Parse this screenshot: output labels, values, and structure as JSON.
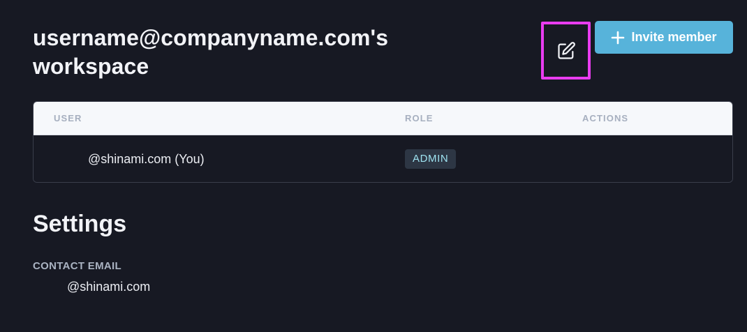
{
  "workspace": {
    "title": "username@companyname.com's workspace"
  },
  "actions": {
    "edit_icon": "edit-icon",
    "invite_label": "Invite member",
    "invite_icon": "plus-icon",
    "accent_color": "#57b3da",
    "highlight_color": "#e93cf0"
  },
  "members_table": {
    "columns": [
      "USER",
      "ROLE",
      "ACTIONS"
    ],
    "rows": [
      {
        "user": "@shinami.com (You)",
        "role": "ADMIN"
      }
    ]
  },
  "settings": {
    "heading": "Settings",
    "contact_email_label": "CONTACT EMAIL",
    "contact_email_value": "@shinami.com"
  }
}
